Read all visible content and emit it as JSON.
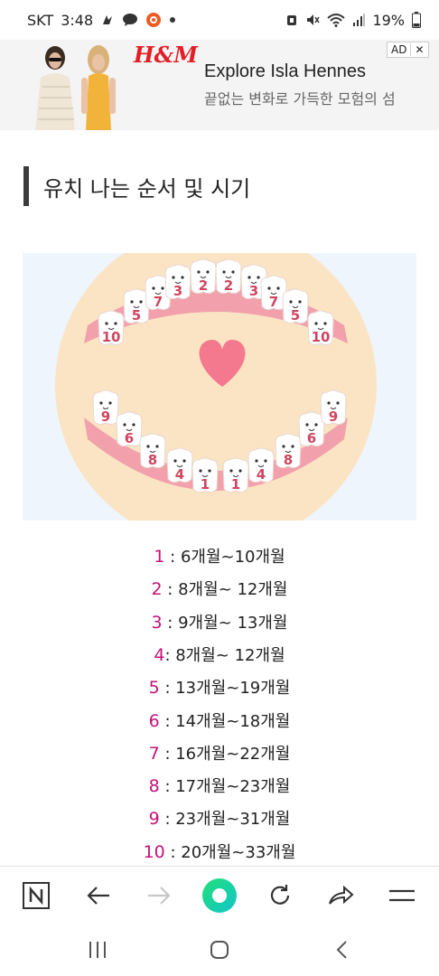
{
  "status_bar": {
    "carrier": "SKT",
    "time": "3:48",
    "battery": "19%",
    "icons": [
      "fingertips-icon",
      "talk-bubble-icon",
      "target-icon",
      "dot-icon",
      "alarm-icon",
      "mute-icon",
      "wifi-icon",
      "signal-icon",
      "battery-icon"
    ]
  },
  "ad": {
    "brand": "H&M",
    "title": "Explore Isla Hennes",
    "subtitle": "끝없는 변화로 가득한 모험의 섬",
    "badge": "AD",
    "close": "✕"
  },
  "article": {
    "section_title": "유치 나는 순서 및 시기"
  },
  "teeth_figure": {
    "upper_labels": [
      "10",
      "5",
      "7",
      "3",
      "2",
      "2",
      "3",
      "7",
      "5",
      "10"
    ],
    "lower_labels": [
      "9",
      "6",
      "8",
      "4",
      "1",
      "1",
      "4",
      "8",
      "6",
      "9"
    ],
    "colors": {
      "face": "#fbe4c4",
      "gum": "#f2a0ab",
      "heart": "#f4788e",
      "number": "#d0455f",
      "background": "#eef5fc"
    }
  },
  "schedule": [
    {
      "num": "1",
      "sep": " : ",
      "period": "6개월~10개월"
    },
    {
      "num": "2",
      "sep": " : ",
      "period": "8개월~ 12개월"
    },
    {
      "num": "3",
      "sep": " : ",
      "period": "9개월~ 13개월"
    },
    {
      "num": "4",
      "sep": ":  ",
      "period": "8개월~ 12개월"
    },
    {
      "num": "5",
      "sep": " : ",
      "period": "13개월~19개월"
    },
    {
      "num": "6",
      "sep": " : ",
      "period": "14개월~18개월"
    },
    {
      "num": "7",
      "sep": " : ",
      "period": "16개월~22개월"
    },
    {
      "num": "8",
      "sep": " : ",
      "period": "17개월~23개월"
    },
    {
      "num": "9",
      "sep": " : ",
      "period": "23개월~31개월"
    },
    {
      "num": "10",
      "sep": " : ",
      "period": "20개월~33개월"
    }
  ],
  "colors": {
    "accent": "#c4127a",
    "title_bar": "#3b3b3b",
    "naver_green": "#19ce60"
  },
  "browser_toolbar": {
    "icons": [
      "naver-n-icon",
      "back-arrow-icon",
      "forward-arrow-icon",
      "green-dot-icon",
      "refresh-icon",
      "share-icon",
      "menu-icon"
    ],
    "naver_label": "N"
  },
  "nav_bar": {
    "icons": [
      "recent-apps-icon",
      "home-icon",
      "back-icon"
    ]
  }
}
